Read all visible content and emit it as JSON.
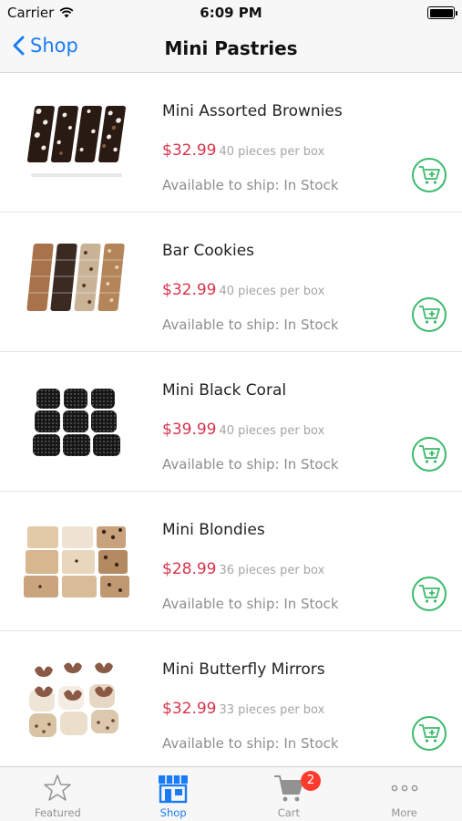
{
  "status_bar": {
    "carrier": "Carrier",
    "time": "6:09 PM"
  },
  "nav": {
    "back_label": "Shop",
    "title": "Mini Pastries"
  },
  "products": [
    {
      "name": "Mini Assorted Brownies",
      "price": "$32.99",
      "pieces": "40 pieces per box",
      "availability": "Available to ship: In Stock",
      "thumb": "brownies"
    },
    {
      "name": "Bar Cookies",
      "price": "$32.99",
      "pieces": "40 pieces per box",
      "availability": "Available to ship: In Stock",
      "thumb": "barcookies"
    },
    {
      "name": "Mini Black Coral",
      "price": "$39.99",
      "pieces": "40 pieces per box",
      "availability": "Available to ship: In Stock",
      "thumb": "blackcoral"
    },
    {
      "name": "Mini Blondies",
      "price": "$28.99",
      "pieces": "36 pieces per box",
      "availability": "Available to ship: In Stock",
      "thumb": "blondies"
    },
    {
      "name": "Mini Butterfly Mirrors",
      "price": "$32.99",
      "pieces": "33 pieces per box",
      "availability": "Available to ship: In Stock",
      "thumb": "butterfly"
    }
  ],
  "tabs": [
    {
      "label": "Featured",
      "icon": "star-icon"
    },
    {
      "label": "Shop",
      "icon": "shop-icon"
    },
    {
      "label": "Cart",
      "icon": "cart-icon"
    },
    {
      "label": "More",
      "icon": "more-icon"
    }
  ],
  "cart_badge": "2",
  "colors": {
    "accent": "#1a7cf5",
    "price": "#d8334a",
    "cart_button": "#3bba6b",
    "badge": "#ff3b30"
  }
}
